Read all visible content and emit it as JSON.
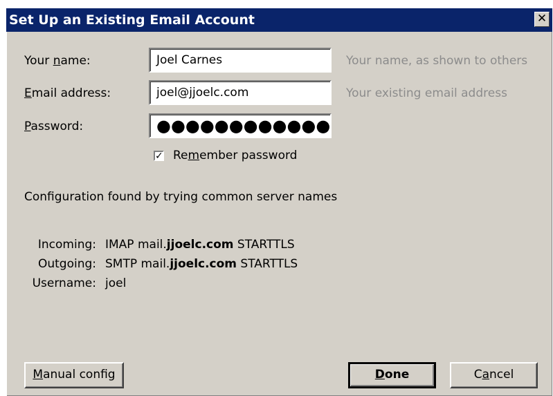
{
  "window": {
    "title": "Set Up an Existing Email Account",
    "close_glyph": "✕"
  },
  "form": {
    "name_label_pre": "Your ",
    "name_label_accel": "n",
    "name_label_post": "ame:",
    "name_value": "Joel Carnes",
    "name_hint": "Your name, as shown to others",
    "email_label_accel": "E",
    "email_label_post": "mail address:",
    "email_value": "joel@jjoelc.com",
    "email_hint": "Your existing email address",
    "password_label_accel": "P",
    "password_label_post": "assword:",
    "password_value": "●●●●●●●●●●●●●●●●●●",
    "remember_checked": true,
    "remember_glyph": "✓",
    "remember_label_pre": "Re",
    "remember_label_accel": "m",
    "remember_label_post": "ember password"
  },
  "config": {
    "status": "Configuration found by trying common server names",
    "incoming_key": "Incoming:",
    "incoming_proto": "IMAP mail.",
    "incoming_host": "jjoelc.com",
    "incoming_security": " STARTTLS",
    "outgoing_key": "Outgoing:",
    "outgoing_proto": "SMTP mail.",
    "outgoing_host": "jjoelc.com",
    "outgoing_security": " STARTTLS",
    "username_key": "Username:",
    "username_value": "joel"
  },
  "buttons": {
    "manual_accel": "M",
    "manual_post": "anual config",
    "done_accel": "D",
    "done_post": "one",
    "cancel_pre": "C",
    "cancel_accel": "a",
    "cancel_post": "ncel"
  },
  "colors": {
    "titlebar": "#0a246a",
    "dialog_bg": "#d4d0c8",
    "hint_text": "#8c8c8c"
  }
}
